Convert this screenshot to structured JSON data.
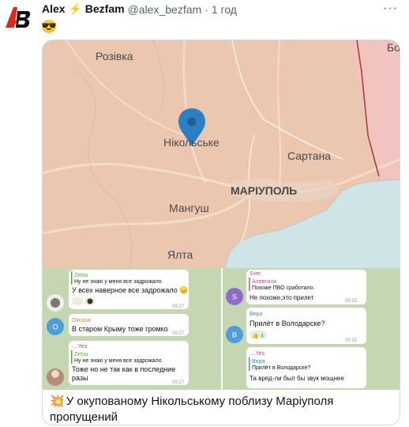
{
  "tweet": {
    "author_name": "Alex ⚡ Bezfam",
    "author_handle": "@alex_bezfam",
    "separator": "·",
    "time": "1 год",
    "more_label": "···",
    "emoji": "😎",
    "avatar_letters": "AB",
    "caption_emoji": "💥",
    "caption": "У окупованому Нікольському поблизу Маріуполя пропущений"
  },
  "map": {
    "labels": {
      "rozivka": "Розівка",
      "nikolske": "Нікольське",
      "sartana": "Сартана",
      "mariupol": "МАРІУПОЛЬ",
      "manhush": "Мангуш",
      "yalta": "Ялта",
      "bo": "Бо"
    },
    "colors": {
      "land": "#ecc7b0",
      "sea": "#cfe4e7",
      "occupied_border": "#a8433f",
      "border": "#c8a094"
    }
  },
  "chats": {
    "left": [
      {
        "sender": "Zetsu",
        "reply_text": "Ну не знаю у меня все задрожало",
        "text": "У всех наверное все задрожало 😞",
        "time": "09:27"
      },
      {
        "sender": "Оксана",
        "avatar_letter": "О",
        "text": "В старом Крыму тоже громко",
        "time": "09:27"
      },
      {
        "sender": "....Yes",
        "reply_sender": "Zetsu",
        "reply_text": "Ну не знаю у меня все задрожало",
        "text_line1": "Тоже но не так как в последние",
        "text_line2": "разы",
        "time": "09:27"
      }
    ],
    "right": [
      {
        "sender": "Svet",
        "reply_sender": "Алевтина",
        "reply_text": "Похоже ПВО сработало.",
        "text": "Не похоже,это прилет",
        "avatar_letter": "S",
        "time": "09:25"
      },
      {
        "sender": "Вера",
        "avatar_letter": "В",
        "text": "Прилёт в Володарске?",
        "reaction_count": "4",
        "time": "09:25"
      },
      {
        "sender": "....Yes",
        "reply_sender": "Вера",
        "reply_text": "Прилёт в Володарске?",
        "text": "Та вряд-ли был бы звук мощнее"
      }
    ]
  }
}
